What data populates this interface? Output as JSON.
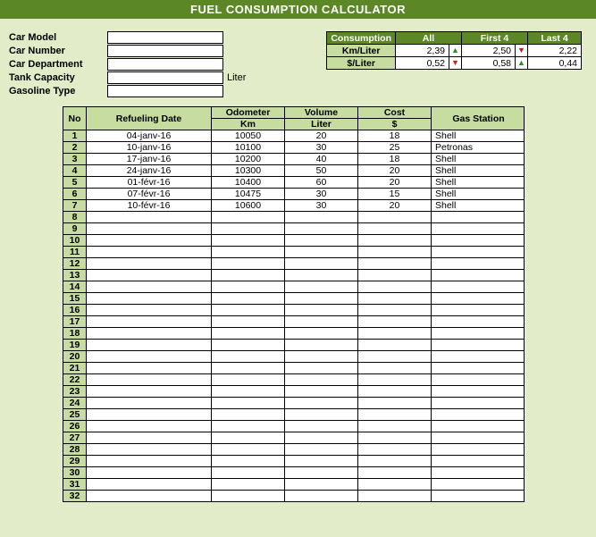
{
  "title": "FUEL CONSUMPTION CALCULATOR",
  "car_info": {
    "labels": {
      "model": "Car Model",
      "number": "Car Number",
      "department": "Car Department",
      "tank": "Tank Capacity",
      "gasoline": "Gasoline Type"
    },
    "tank_unit": "Liter"
  },
  "consumption": {
    "header": "Consumption",
    "cols": {
      "all": "All",
      "first4": "First 4",
      "last4": "Last 4"
    },
    "rows": [
      {
        "label": "Km/Liter",
        "all": "2,39",
        "all_dir": "up",
        "first4": "2,50",
        "first4_dir": "down",
        "last4": "2,22"
      },
      {
        "label": "$/Liter",
        "all": "0,52",
        "all_dir": "down",
        "first4": "0,58",
        "first4_dir": "up",
        "last4": "0,44"
      }
    ]
  },
  "log": {
    "headers": {
      "no": "No",
      "date": "Refueling Date",
      "odo": "Odometer",
      "odo_sub": "Km",
      "vol": "Volume",
      "vol_sub": "Liter",
      "cost": "Cost",
      "cost_sub": "$",
      "gas": "Gas Station"
    },
    "rows": [
      {
        "no": "1",
        "date": "04-janv-16",
        "odo": "10050",
        "vol": "20",
        "cost": "18",
        "gas": "Shell"
      },
      {
        "no": "2",
        "date": "10-janv-16",
        "odo": "10100",
        "vol": "30",
        "cost": "25",
        "gas": "Petronas"
      },
      {
        "no": "3",
        "date": "17-janv-16",
        "odo": "10200",
        "vol": "40",
        "cost": "18",
        "gas": "Shell"
      },
      {
        "no": "4",
        "date": "24-janv-16",
        "odo": "10300",
        "vol": "50",
        "cost": "20",
        "gas": "Shell"
      },
      {
        "no": "5",
        "date": "01-févr-16",
        "odo": "10400",
        "vol": "60",
        "cost": "20",
        "gas": "Shell"
      },
      {
        "no": "6",
        "date": "07-févr-16",
        "odo": "10475",
        "vol": "30",
        "cost": "15",
        "gas": "Shell"
      },
      {
        "no": "7",
        "date": "10-févr-16",
        "odo": "10600",
        "vol": "30",
        "cost": "20",
        "gas": "Shell"
      },
      {
        "no": "8"
      },
      {
        "no": "9"
      },
      {
        "no": "10"
      },
      {
        "no": "11"
      },
      {
        "no": "12"
      },
      {
        "no": "13"
      },
      {
        "no": "14"
      },
      {
        "no": "15"
      },
      {
        "no": "16"
      },
      {
        "no": "17"
      },
      {
        "no": "18"
      },
      {
        "no": "19"
      },
      {
        "no": "20"
      },
      {
        "no": "21"
      },
      {
        "no": "22"
      },
      {
        "no": "23"
      },
      {
        "no": "24"
      },
      {
        "no": "25"
      },
      {
        "no": "26"
      },
      {
        "no": "27"
      },
      {
        "no": "28"
      },
      {
        "no": "29"
      },
      {
        "no": "30"
      },
      {
        "no": "31"
      },
      {
        "no": "32"
      }
    ]
  }
}
